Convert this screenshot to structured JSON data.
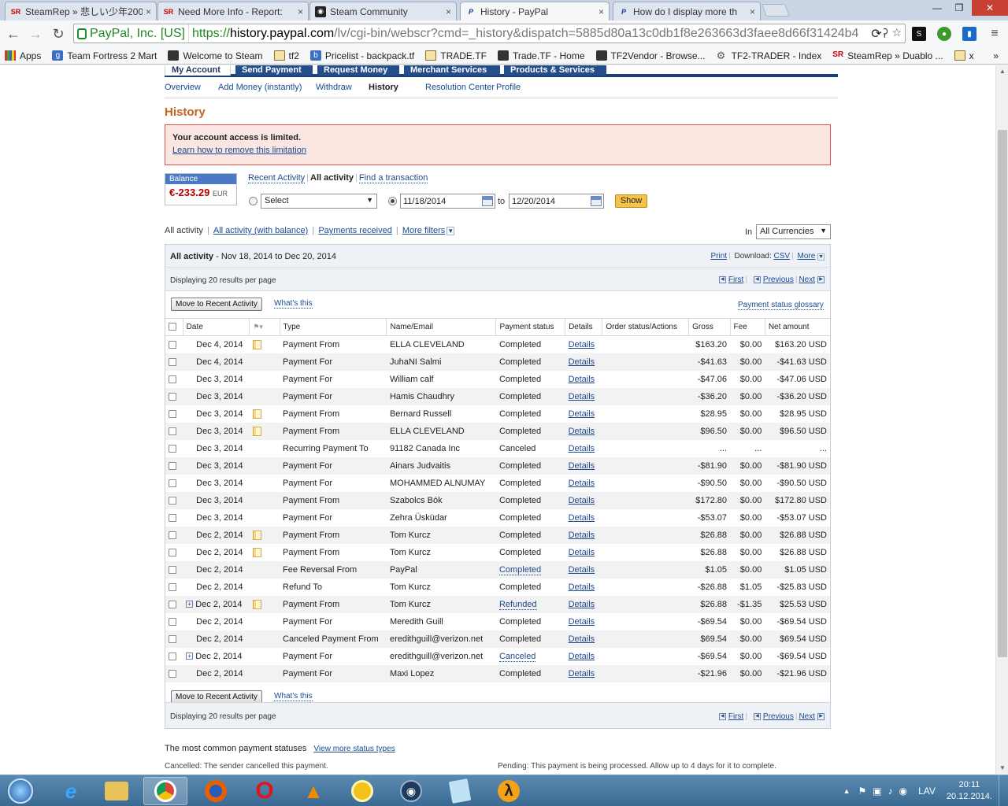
{
  "browser": {
    "tabs": [
      {
        "favicon": "SR",
        "title": "SteamRep » 悲しい少年200"
      },
      {
        "favicon": "SR",
        "title": "Need More Info - Report:"
      },
      {
        "favicon": "steam-icon",
        "title": "Steam Community"
      },
      {
        "favicon": "P",
        "title": "History - PayPal"
      },
      {
        "favicon": "P",
        "title": "How do I display more th"
      }
    ],
    "tab_close": "×",
    "window_controls": {
      "minimize": "—",
      "maximize": "❐",
      "close": "✕"
    },
    "address": {
      "ev_badge": "PayPal, Inc. [US]",
      "protocol": "https://",
      "host": "history.paypal.com",
      "path": "/lv/cgi-bin/webscr?cmd=_history&dispatch=5885d80a13c0db1f8e263663d3faee8d66f31424b4"
    },
    "bookmarks": [
      {
        "icon": "apps-grid-icon",
        "label": "Apps"
      },
      {
        "icon": "g-icon",
        "label": "Team Fortress 2 Mart"
      },
      {
        "icon": "steam-icon",
        "label": "Welcome to Steam"
      },
      {
        "icon": "folder-icon",
        "label": "tf2"
      },
      {
        "icon": "backpack-icon",
        "label": "Pricelist - backpack.tf"
      },
      {
        "icon": "folder-icon",
        "label": "TRADE.TF"
      },
      {
        "icon": "tf-icon",
        "label": "Trade.TF - Home"
      },
      {
        "icon": "vendor-icon",
        "label": "TF2Vendor - Browse..."
      },
      {
        "icon": "gear-icon",
        "label": "TF2-TRADER - Index"
      },
      {
        "icon": "SR",
        "label": "SteamRep » Duablo ..."
      },
      {
        "icon": "folder-icon",
        "label": "x"
      }
    ],
    "bookmarks_more": "»"
  },
  "paypal": {
    "main_nav": [
      "My Account",
      "Send Payment",
      "Request Money",
      "Merchant Services",
      "Products & Services"
    ],
    "sub_nav": [
      "Overview",
      "Add Money (instantly)",
      "Withdraw",
      "History",
      "Resolution Center",
      "Profile"
    ],
    "page_title": "History",
    "alert": {
      "title": "Your account access is limited.",
      "link": "Learn how to remove this limitation"
    },
    "balance": {
      "label": "Balance",
      "amount": "€-233.29",
      "currency": "EUR"
    },
    "activity_tabs": {
      "recent": "Recent Activity",
      "all": "All activity",
      "find": "Find a transaction"
    },
    "search": {
      "select": "Select",
      "from": "11/18/2014",
      "to_label": "to",
      "to": "12/20/2014",
      "show": "Show"
    },
    "filters": {
      "current": "All activity",
      "with_balance": "All activity (with balance)",
      "received": "Payments received",
      "more": "More filters",
      "in_label": "In",
      "currency": "All Currencies"
    },
    "panel": {
      "title": "All activity",
      "range": "- Nov 18, 2014 to Dec 20, 2014",
      "print": "Print",
      "download_label": "Download:",
      "csv": "CSV",
      "more": "More",
      "displaying": "Displaying 20 results per page",
      "pager": {
        "first": "First",
        "previous": "Previous",
        "next": "Next"
      },
      "move_btn": "Move to Recent Activity",
      "whats_this": "What's this",
      "glossary": "Payment status glossary"
    },
    "columns": [
      "Date",
      "Type",
      "Name/Email",
      "Payment status",
      "Details",
      "Order status/Actions",
      "Gross",
      "Fee",
      "Net amount"
    ],
    "rows": [
      {
        "plus": false,
        "date": "Dec 4, 2014",
        "note": true,
        "type": "Payment From",
        "name": "ELLA CLEVELAND",
        "status": "Completed",
        "status_link": false,
        "details": "Details",
        "gross": "$163.20",
        "fee": "$0.00",
        "net": "$163.20 USD"
      },
      {
        "plus": false,
        "date": "Dec 4, 2014",
        "note": false,
        "type": "Payment For",
        "name": "JuhaNI Salmi",
        "status": "Completed",
        "status_link": false,
        "details": "Details",
        "gross": "-$41.63",
        "fee": "$0.00",
        "net": "-$41.63 USD"
      },
      {
        "plus": false,
        "date": "Dec 3, 2014",
        "note": false,
        "type": "Payment For",
        "name": "William calf",
        "status": "Completed",
        "status_link": false,
        "details": "Details",
        "gross": "-$47.06",
        "fee": "$0.00",
        "net": "-$47.06 USD"
      },
      {
        "plus": false,
        "date": "Dec 3, 2014",
        "note": false,
        "type": "Payment For",
        "name": "Hamis Chaudhry",
        "status": "Completed",
        "status_link": false,
        "details": "Details",
        "gross": "-$36.20",
        "fee": "$0.00",
        "net": "-$36.20 USD"
      },
      {
        "plus": false,
        "date": "Dec 3, 2014",
        "note": true,
        "type": "Payment From",
        "name": "Bernard Russell",
        "status": "Completed",
        "status_link": false,
        "details": "Details",
        "gross": "$28.95",
        "fee": "$0.00",
        "net": "$28.95 USD"
      },
      {
        "plus": false,
        "date": "Dec 3, 2014",
        "note": true,
        "type": "Payment From",
        "name": "ELLA CLEVELAND",
        "status": "Completed",
        "status_link": false,
        "details": "Details",
        "gross": "$96.50",
        "fee": "$0.00",
        "net": "$96.50 USD"
      },
      {
        "plus": false,
        "date": "Dec 3, 2014",
        "note": false,
        "type": "Recurring Payment To",
        "name": "91182 Canada Inc",
        "status": "Canceled",
        "status_link": false,
        "details": "Details",
        "gross": "...",
        "fee": "...",
        "net": "..."
      },
      {
        "plus": false,
        "date": "Dec 3, 2014",
        "note": false,
        "type": "Payment For",
        "name": "Ainars Judvaitis",
        "status": "Completed",
        "status_link": false,
        "details": "Details",
        "gross": "-$81.90",
        "fee": "$0.00",
        "net": "-$81.90 USD"
      },
      {
        "plus": false,
        "date": "Dec 3, 2014",
        "note": false,
        "type": "Payment For",
        "name": "MOHAMMED ALNUMAY",
        "status": "Completed",
        "status_link": false,
        "details": "Details",
        "gross": "-$90.50",
        "fee": "$0.00",
        "net": "-$90.50 USD"
      },
      {
        "plus": false,
        "date": "Dec 3, 2014",
        "note": false,
        "type": "Payment From",
        "name": "Szabolcs Bók",
        "status": "Completed",
        "status_link": false,
        "details": "Details",
        "gross": "$172.80",
        "fee": "$0.00",
        "net": "$172.80 USD"
      },
      {
        "plus": false,
        "date": "Dec 3, 2014",
        "note": false,
        "type": "Payment For",
        "name": "Zehra Üsküdar",
        "status": "Completed",
        "status_link": false,
        "details": "Details",
        "gross": "-$53.07",
        "fee": "$0.00",
        "net": "-$53.07 USD"
      },
      {
        "plus": false,
        "date": "Dec 2, 2014",
        "note": true,
        "type": "Payment From",
        "name": "Tom Kurcz",
        "status": "Completed",
        "status_link": false,
        "details": "Details",
        "gross": "$26.88",
        "fee": "$0.00",
        "net": "$26.88 USD"
      },
      {
        "plus": false,
        "date": "Dec 2, 2014",
        "note": true,
        "type": "Payment From",
        "name": "Tom Kurcz",
        "status": "Completed",
        "status_link": false,
        "details": "Details",
        "gross": "$26.88",
        "fee": "$0.00",
        "net": "$26.88 USD"
      },
      {
        "plus": false,
        "date": "Dec 2, 2014",
        "note": false,
        "type": "Fee Reversal From",
        "name": "PayPal",
        "status": "Completed",
        "status_link": true,
        "details": "Details",
        "gross": "$1.05",
        "fee": "$0.00",
        "net": "$1.05 USD"
      },
      {
        "plus": false,
        "date": "Dec 2, 2014",
        "note": false,
        "type": "Refund To",
        "name": "Tom Kurcz",
        "status": "Completed",
        "status_link": false,
        "details": "Details",
        "gross": "-$26.88",
        "fee": "$1.05",
        "net": "-$25.83 USD"
      },
      {
        "plus": true,
        "date": "Dec 2, 2014",
        "note": true,
        "type": "Payment From",
        "name": "Tom Kurcz",
        "status": "Refunded",
        "status_link": true,
        "details": "Details",
        "gross": "$26.88",
        "fee": "-$1.35",
        "net": "$25.53 USD"
      },
      {
        "plus": false,
        "date": "Dec 2, 2014",
        "note": false,
        "type": "Payment For",
        "name": "Meredith Guill",
        "status": "Completed",
        "status_link": false,
        "details": "Details",
        "gross": "-$69.54",
        "fee": "$0.00",
        "net": "-$69.54 USD"
      },
      {
        "plus": false,
        "date": "Dec 2, 2014",
        "note": false,
        "type": "Canceled Payment From",
        "name": "eredithguill@verizon.net",
        "status": "Completed",
        "status_link": false,
        "details": "Details",
        "gross": "$69.54",
        "fee": "$0.00",
        "net": "$69.54 USD"
      },
      {
        "plus": true,
        "date": "Dec 2, 2014",
        "note": false,
        "type": "Payment For",
        "name": "eredithguill@verizon.net",
        "status": "Canceled",
        "status_link": true,
        "details": "Details",
        "gross": "-$69.54",
        "fee": "$0.00",
        "net": "-$69.54 USD"
      },
      {
        "plus": false,
        "date": "Dec 2, 2014",
        "note": false,
        "type": "Payment For",
        "name": "Maxi Lopez",
        "status": "Completed",
        "status_link": false,
        "details": "Details",
        "gross": "-$21.96",
        "fee": "$0.00",
        "net": "-$21.96 USD"
      }
    ],
    "footer": {
      "common_label": "The most common payment statuses",
      "view_more": "View more status types",
      "cancelled": "Cancelled:  The sender cancelled this payment.",
      "pending": "Pending:  This payment is being processed. Allow up to 4 days for it to complete."
    }
  },
  "taskbar": {
    "items": [
      "start-orb-icon",
      "internet-explorer-icon",
      "file-explorer-icon",
      "chrome-icon",
      "firefox-icon",
      "opera-icon",
      "vlc-icon",
      "chrome-canary-icon",
      "steam-icon",
      "notepad-icon",
      "half-life-icon"
    ],
    "language": "LAV",
    "time": "20:11",
    "date": "20.12.2014."
  },
  "colors": {
    "paypal_nav": "#234e8b",
    "title_orange": "#c8631b",
    "alert_bg": "#fbe6e1",
    "balance_red": "#b80000",
    "link_blue": "#1b4a8f",
    "show_btn": "#f5c24b"
  }
}
